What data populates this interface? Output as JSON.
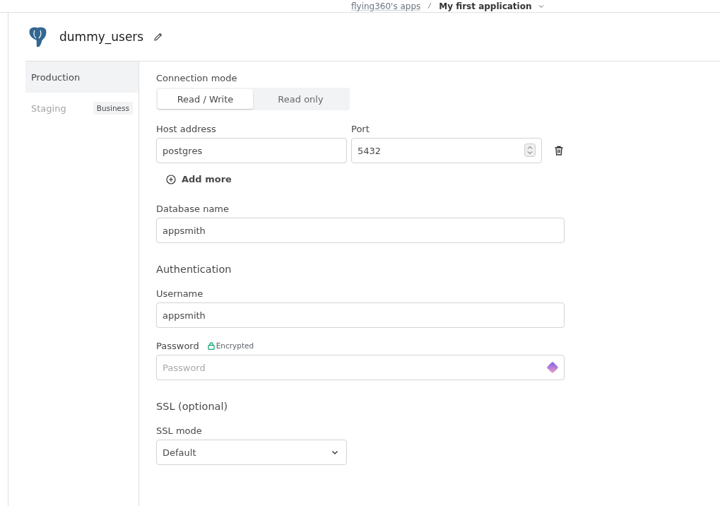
{
  "breadcrumb": [
    {
      "label": "flying360's apps",
      "kind": "link"
    },
    {
      "label": "My first application",
      "kind": "current"
    }
  ],
  "datasource": {
    "name": "dummy_users"
  },
  "environments": [
    {
      "label": "Production",
      "selected": true
    },
    {
      "label": "Staging",
      "selected": false,
      "badge": "Business"
    }
  ],
  "connection_mode": {
    "label": "Connection mode",
    "options": [
      {
        "label": "Read / Write",
        "selected": true
      },
      {
        "label": "Read only",
        "selected": false
      }
    ]
  },
  "host": {
    "label": "Host address",
    "value": "postgres"
  },
  "port": {
    "label": "Port",
    "value": "5432"
  },
  "add_more": "Add more",
  "database": {
    "label": "Database name",
    "value": "appsmith"
  },
  "authentication": {
    "heading": "Authentication",
    "username": {
      "label": "Username",
      "value": "appsmith"
    },
    "password": {
      "label": "Password",
      "badge": "Encrypted",
      "placeholder": "Password"
    }
  },
  "ssl": {
    "heading": "SSL (optional)",
    "mode": {
      "label": "SSL mode",
      "value": "Default"
    }
  }
}
